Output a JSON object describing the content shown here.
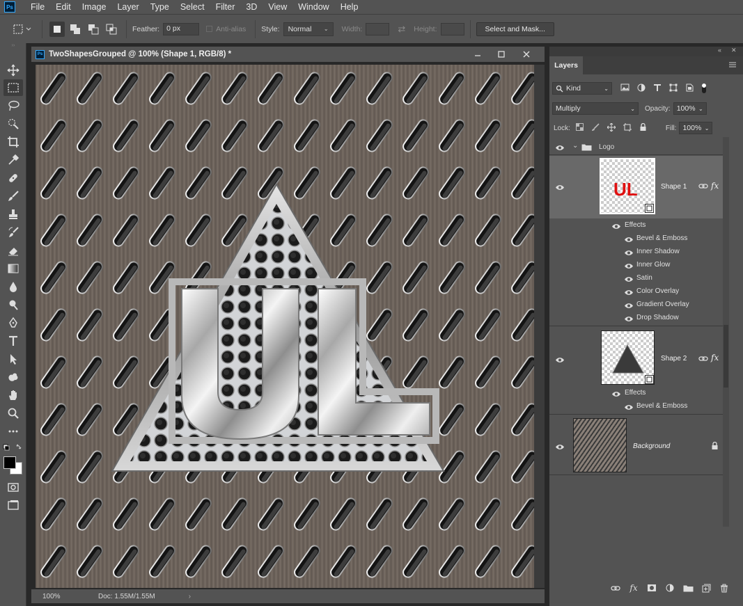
{
  "app": {
    "logo_text": "Ps"
  },
  "menu": [
    "File",
    "Edit",
    "Image",
    "Layer",
    "Type",
    "Select",
    "Filter",
    "3D",
    "View",
    "Window",
    "Help"
  ],
  "options": {
    "feather_label": "Feather:",
    "feather_value": "0 px",
    "antialias_label": "Anti-alias",
    "style_label": "Style:",
    "style_value": "Normal",
    "width_label": "Width:",
    "height_label": "Height:",
    "select_mask_button": "Select and Mask..."
  },
  "tools": [
    "move-tool-icon",
    "marquee-tool-icon",
    "lasso-tool-icon",
    "quick-select-tool-icon",
    "crop-tool-icon",
    "eyedropper-tool-icon",
    "healing-brush-tool-icon",
    "brush-tool-icon",
    "clone-stamp-tool-icon",
    "history-brush-tool-icon",
    "eraser-tool-icon",
    "gradient-tool-icon",
    "blur-tool-icon",
    "dodge-tool-icon",
    "pen-tool-icon",
    "type-tool-icon",
    "path-selection-tool-icon",
    "custom-shape-tool-icon",
    "hand-tool-icon",
    "zoom-tool-icon",
    "more-tools-icon"
  ],
  "document": {
    "title": "TwoShapesGrouped @ 100% (Shape 1, RGB/8) *",
    "zoom": "100%",
    "doc_size": "Doc: 1.55M/1.55M"
  },
  "layers_panel": {
    "tab": "Layers",
    "kind_label": "Kind",
    "blend_mode": "Multiply",
    "opacity_label": "Opacity:",
    "opacity_value": "100%",
    "lock_label": "Lock:",
    "fill_label": "Fill:",
    "fill_value": "100%",
    "group_name": "Logo",
    "shape1": {
      "name": "Shape 1",
      "thumb_text": "UL",
      "effects_label": "Effects",
      "effects": [
        "Bevel & Emboss",
        "Inner Shadow",
        "Inner Glow",
        "Satin",
        "Color Overlay",
        "Gradient Overlay",
        "Drop Shadow"
      ]
    },
    "shape2": {
      "name": "Shape 2",
      "effects_label": "Effects",
      "effects": [
        "Bevel & Emboss"
      ]
    },
    "background": {
      "name": "Background"
    }
  },
  "colors": {
    "ui_dark": "#535353",
    "ui_darker": "#282828",
    "selected_layer": "#696969",
    "thumb_text_red": "#e01010",
    "ps_blue": "#31a8ff"
  }
}
